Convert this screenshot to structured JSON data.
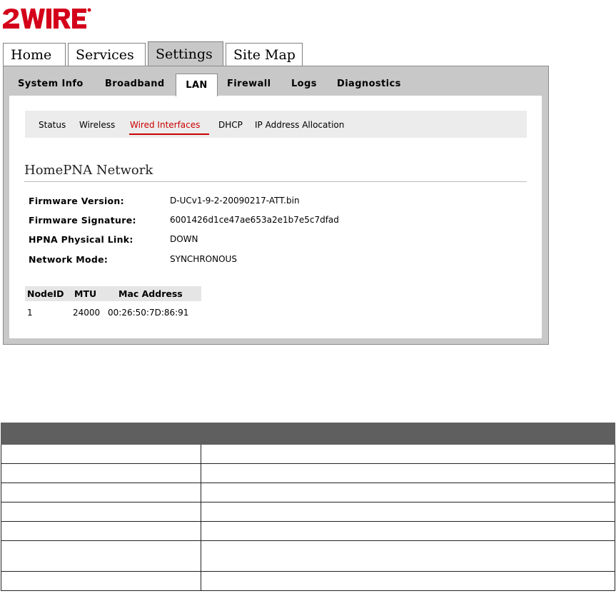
{
  "brand": {
    "logo_text": "2WIRE"
  },
  "main_tabs": [
    {
      "label": "Home",
      "active": false
    },
    {
      "label": "Services",
      "active": false
    },
    {
      "label": "Settings",
      "active": true
    },
    {
      "label": "Site Map",
      "active": false
    }
  ],
  "sub_tabs": [
    {
      "label": "System Info"
    },
    {
      "label": "Broadband"
    },
    {
      "label": "LAN",
      "active": true
    },
    {
      "label": "Firewall"
    },
    {
      "label": "Logs"
    },
    {
      "label": "Diagnostics"
    }
  ],
  "lan_nav": [
    {
      "label": "Status"
    },
    {
      "label": "Wireless"
    },
    {
      "label": "Wired Interfaces",
      "active": true
    },
    {
      "label": "DHCP"
    },
    {
      "label": "IP Address Allocation"
    }
  ],
  "section": {
    "title": "HomePNA Network"
  },
  "fields": [
    {
      "label": "Firmware Version:",
      "value": "D-UCv1-9-2-20090217-ATT.bin"
    },
    {
      "label": "Firmware Signature:",
      "value": "6001426d1ce47ae653a2e1b7e5c7dfad"
    },
    {
      "label": "HPNA Physical Link:",
      "value": "DOWN"
    },
    {
      "label": "Network Mode:",
      "value": "SYNCHRONOUS"
    }
  ],
  "nodes": {
    "headers": [
      "NodeID",
      "MTU",
      "Mac Address"
    ],
    "rows": [
      [
        "1",
        "24000",
        "00:26:50:7D:86:91"
      ]
    ]
  },
  "colors": {
    "accent": "#cc0000",
    "frame": "#c8c8c8",
    "table_header": "#5f5f5f"
  }
}
